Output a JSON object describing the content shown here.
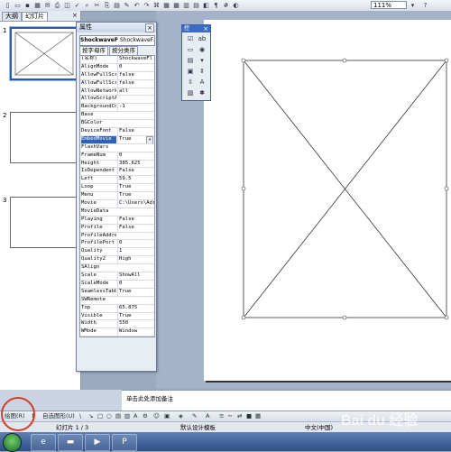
{
  "toolbar": {
    "zoom": "111%",
    "icons": [
      "new-icon",
      "open-icon",
      "save-icon",
      "permission-icon",
      "email-icon",
      "print-icon",
      "print-preview-icon",
      "spelling-icon",
      "research-icon",
      "cut-icon",
      "copy-icon",
      "paste-icon",
      "format-painter-icon",
      "undo-icon",
      "redo-icon",
      "hyperlink-icon",
      "tables-borders-icon",
      "insert-table-icon",
      "insert-chart-icon",
      "new-slide-icon",
      "expand-icon",
      "show-formatting-icon",
      "grid-icon",
      "color-grayscale-icon"
    ]
  },
  "left_pane": {
    "tabs": [
      "大纲",
      "幻灯片"
    ],
    "close": "×",
    "slide_numbers": [
      "1",
      "2",
      "3"
    ]
  },
  "properties": {
    "title": "属性",
    "close": "×",
    "object_name": "ShockwaveF",
    "object_type": "ShockwaveF...",
    "tabs": [
      "按字母序",
      "按分类序"
    ],
    "rows": [
      {
        "k": "(名称)",
        "v": "ShockwaveFl"
      },
      {
        "k": "AlignMode",
        "v": "0"
      },
      {
        "k": "AllowFullScri",
        "v": "false"
      },
      {
        "k": "AllowFullScri",
        "v": "false"
      },
      {
        "k": "AllowNetworki",
        "v": "all"
      },
      {
        "k": "AllowScriptAc",
        "v": ""
      },
      {
        "k": "BackgroundCol",
        "v": "-1"
      },
      {
        "k": "Base",
        "v": ""
      },
      {
        "k": "BGColor",
        "v": ""
      },
      {
        "k": "DeviceFont",
        "v": "False"
      },
      {
        "k": "EmbedMovie",
        "v": "True",
        "highlight": true
      },
      {
        "k": "FlashVars",
        "v": ""
      },
      {
        "k": "FrameNum",
        "v": "0"
      },
      {
        "k": "Height",
        "v": "385.625"
      },
      {
        "k": "IsDependent",
        "v": "False"
      },
      {
        "k": "Left",
        "v": "59.5"
      },
      {
        "k": "Loop",
        "v": "True"
      },
      {
        "k": "Menu",
        "v": "True"
      },
      {
        "k": "Movie",
        "v": "C:\\Users\\Adr"
      },
      {
        "k": "MovieData",
        "v": ""
      },
      {
        "k": "Playing",
        "v": "False"
      },
      {
        "k": "Profile",
        "v": "False"
      },
      {
        "k": "ProfileAddres",
        "v": ""
      },
      {
        "k": "ProfilePort",
        "v": "0"
      },
      {
        "k": "Quality",
        "v": "1"
      },
      {
        "k": "Quality2",
        "v": "High"
      },
      {
        "k": "SAlign",
        "v": ""
      },
      {
        "k": "Scale",
        "v": "ShowAll"
      },
      {
        "k": "ScaleMode",
        "v": "0"
      },
      {
        "k": "SeamlessTabbi",
        "v": "True"
      },
      {
        "k": "SWRemote",
        "v": ""
      },
      {
        "k": "Top",
        "v": "65.875"
      },
      {
        "k": "Visible",
        "v": "True"
      },
      {
        "k": "Width",
        "v": "550"
      },
      {
        "k": "WMode",
        "v": "Window"
      }
    ]
  },
  "palette": {
    "title": "控",
    "icons": [
      "checkbox-icon",
      "text-box-icon",
      "command-button-icon",
      "option-button-icon",
      "list-box-icon",
      "combo-box-icon",
      "toggle-button-icon",
      "spin-button-icon",
      "scroll-bar-icon",
      "label-icon",
      "image-icon",
      "more-controls-icon"
    ]
  },
  "notes": {
    "placeholder": "单击此处添加备注"
  },
  "drawbar": {
    "draw": "绘图(R)",
    "autoshapes": "自选图形(U)"
  },
  "status": {
    "slide": "幻灯片 1 / 3",
    "template": "默认设计模板",
    "language": "中文(中国)"
  },
  "watermark": "Bai du 经验",
  "colors": {
    "accent": "#2f62b6",
    "slide_bg": "#ffffff",
    "annotation": "#d63a2a"
  }
}
